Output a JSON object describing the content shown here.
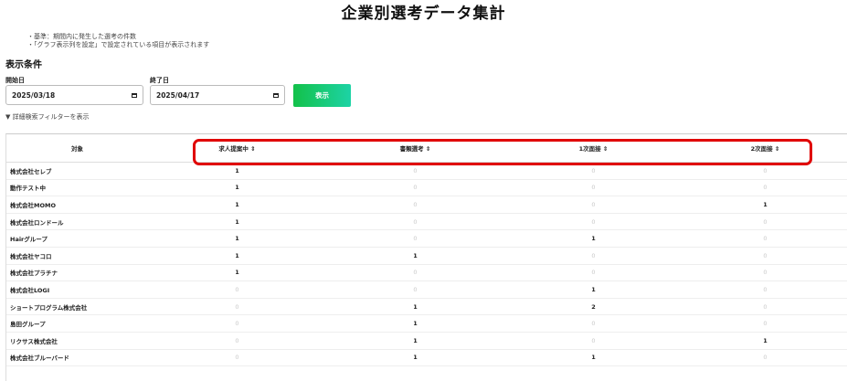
{
  "title": "企業別選考データ集計",
  "notes": [
    "・基準：期間内に発生した選考の件数",
    "・「グラフ表示列を設定」で設定されている項目が表示されます"
  ],
  "conditions": {
    "heading": "表示条件",
    "start_label": "開始日",
    "start_value": "2025/03/18",
    "end_label": "終了日",
    "end_value": "2025/04/17",
    "show_button": "表示",
    "filter_toggle": "▼ 詳細検索フィルターを表示"
  },
  "table": {
    "headers": [
      "対象",
      "求人提案中 ⇕",
      "書類選考 ⇕",
      "1次面接 ⇕",
      "2次面接 ⇕"
    ],
    "rows": [
      {
        "name": "株式会社セレブ",
        "values": [
          "1",
          "0",
          "0",
          "0"
        ]
      },
      {
        "name": "動作テスト中",
        "values": [
          "1",
          "0",
          "0",
          "0"
        ]
      },
      {
        "name": "株式会社MOMO",
        "values": [
          "1",
          "0",
          "0",
          "1"
        ]
      },
      {
        "name": "株式会社ロンドール",
        "values": [
          "1",
          "0",
          "0",
          "0"
        ]
      },
      {
        "name": "Hairグループ",
        "values": [
          "1",
          "0",
          "1",
          "0"
        ]
      },
      {
        "name": "株式会社ヤコロ",
        "values": [
          "1",
          "1",
          "0",
          "0"
        ]
      },
      {
        "name": "株式会社プラチナ",
        "values": [
          "1",
          "0",
          "0",
          "0"
        ]
      },
      {
        "name": "株式会社LOGI",
        "values": [
          "0",
          "0",
          "1",
          "0"
        ]
      },
      {
        "name": "ショートプログラム株式会社",
        "values": [
          "0",
          "1",
          "2",
          "0"
        ]
      },
      {
        "name": "島田グループ",
        "values": [
          "0",
          "1",
          "0",
          "0"
        ]
      },
      {
        "name": "リクサス株式会社",
        "values": [
          "0",
          "1",
          "0",
          "1"
        ]
      },
      {
        "name": "株式会社ブルーバード",
        "values": [
          "0",
          "1",
          "1",
          "0"
        ]
      }
    ]
  },
  "colors": {
    "button_gradient_start": "#13c14a",
    "button_gradient_end": "#1dd3a5",
    "highlight": "#e00000"
  }
}
